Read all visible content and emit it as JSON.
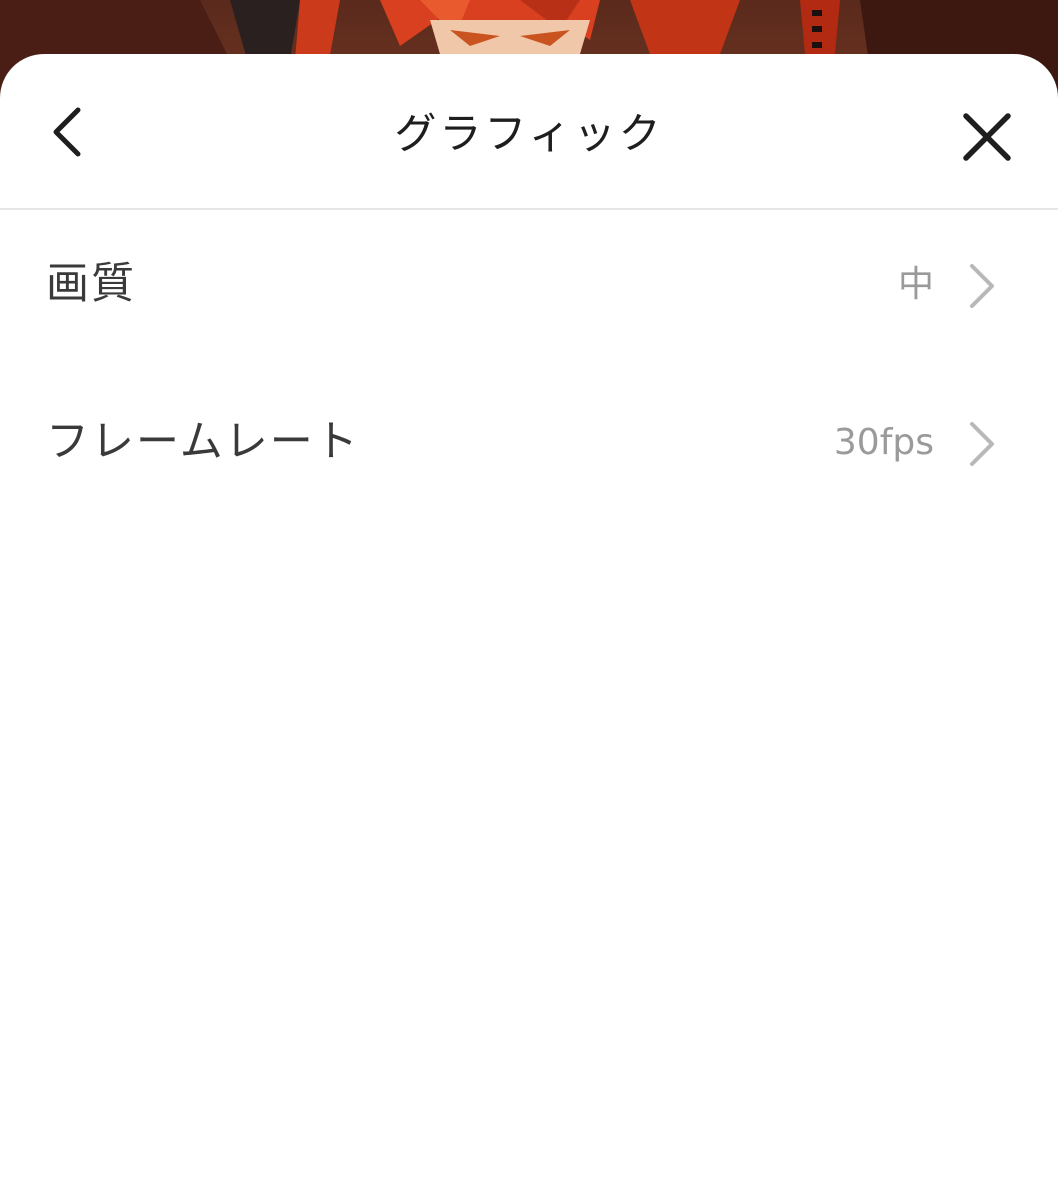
{
  "header": {
    "title": "グラフィック"
  },
  "settings": [
    {
      "label": "画質",
      "value": "中"
    },
    {
      "label": "フレームレート",
      "value": "30fps"
    }
  ],
  "icons": {
    "back": "chevron-left-icon",
    "close": "close-icon",
    "row_arrow": "chevron-right-icon"
  },
  "colors": {
    "sheet_background": "#ffffff",
    "title_text": "#1e1e1e",
    "label_text": "#3a3a3a",
    "value_text": "#9a9a9a",
    "chevron": "#b8b8b8",
    "divider": "#e6e6e6"
  }
}
